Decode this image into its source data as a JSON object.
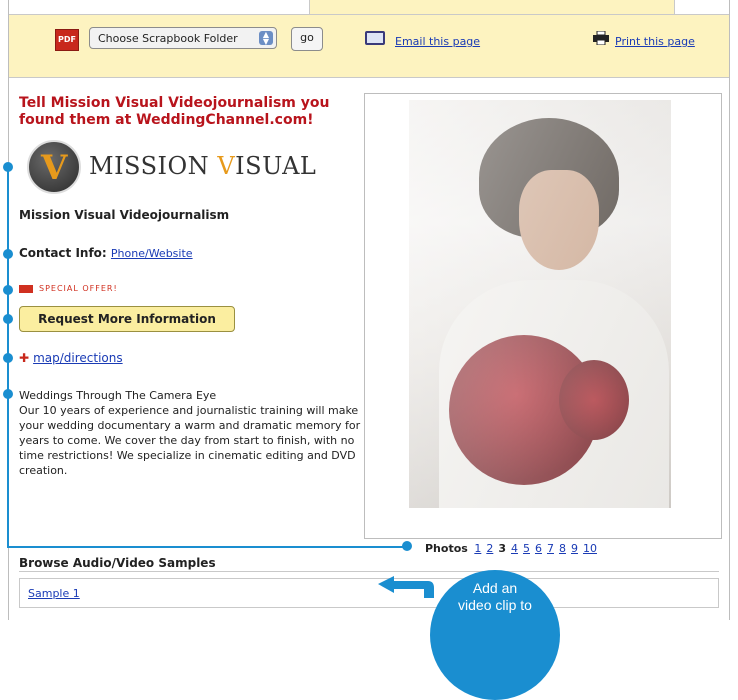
{
  "toolbar": {
    "pdf_label": "PDF",
    "scrapbook_select": "Choose Scrapbook Folder",
    "go_label": "go",
    "email_link": "Email this page",
    "print_link": "Print this page"
  },
  "vendor": {
    "headline": "Tell Mission Visual Videojournalism you found them at WeddingChannel.com!",
    "logo_text_a": "MISSION ",
    "logo_text_v": "V",
    "logo_text_b": "ISUAL",
    "logo_letter": "V",
    "company_name": "Mission Visual Videojournalism",
    "contact_label": "Contact Info:",
    "contact_link": "Phone/Website",
    "special_offer": "SPECIAL OFFER!",
    "request_button": "Request More Information",
    "map_link": "map/directions",
    "desc_title": "Weddings Through The Camera Eye",
    "description": "Our 10 years of experience and journalistic training will make your wedding documentary a warm and dramatic memory for years to come. We cover the day from start to finish, with no time restrictions! We specialize in cinematic editing and DVD creation."
  },
  "photos": {
    "label": "Photos",
    "pages": [
      "1",
      "2",
      "3",
      "4",
      "5",
      "6",
      "7",
      "8",
      "9",
      "10"
    ],
    "current": "3"
  },
  "browse": {
    "heading": "Browse Audio/Video Samples",
    "sample_link": "Sample 1"
  },
  "callout": {
    "line1": "Add an",
    "line2": "video clip to"
  },
  "colors": {
    "toolbar_bg": "#fdf3c0",
    "headline": "#b8141c",
    "link": "#1a3bb5",
    "annotation": "#1a8ed0"
  }
}
